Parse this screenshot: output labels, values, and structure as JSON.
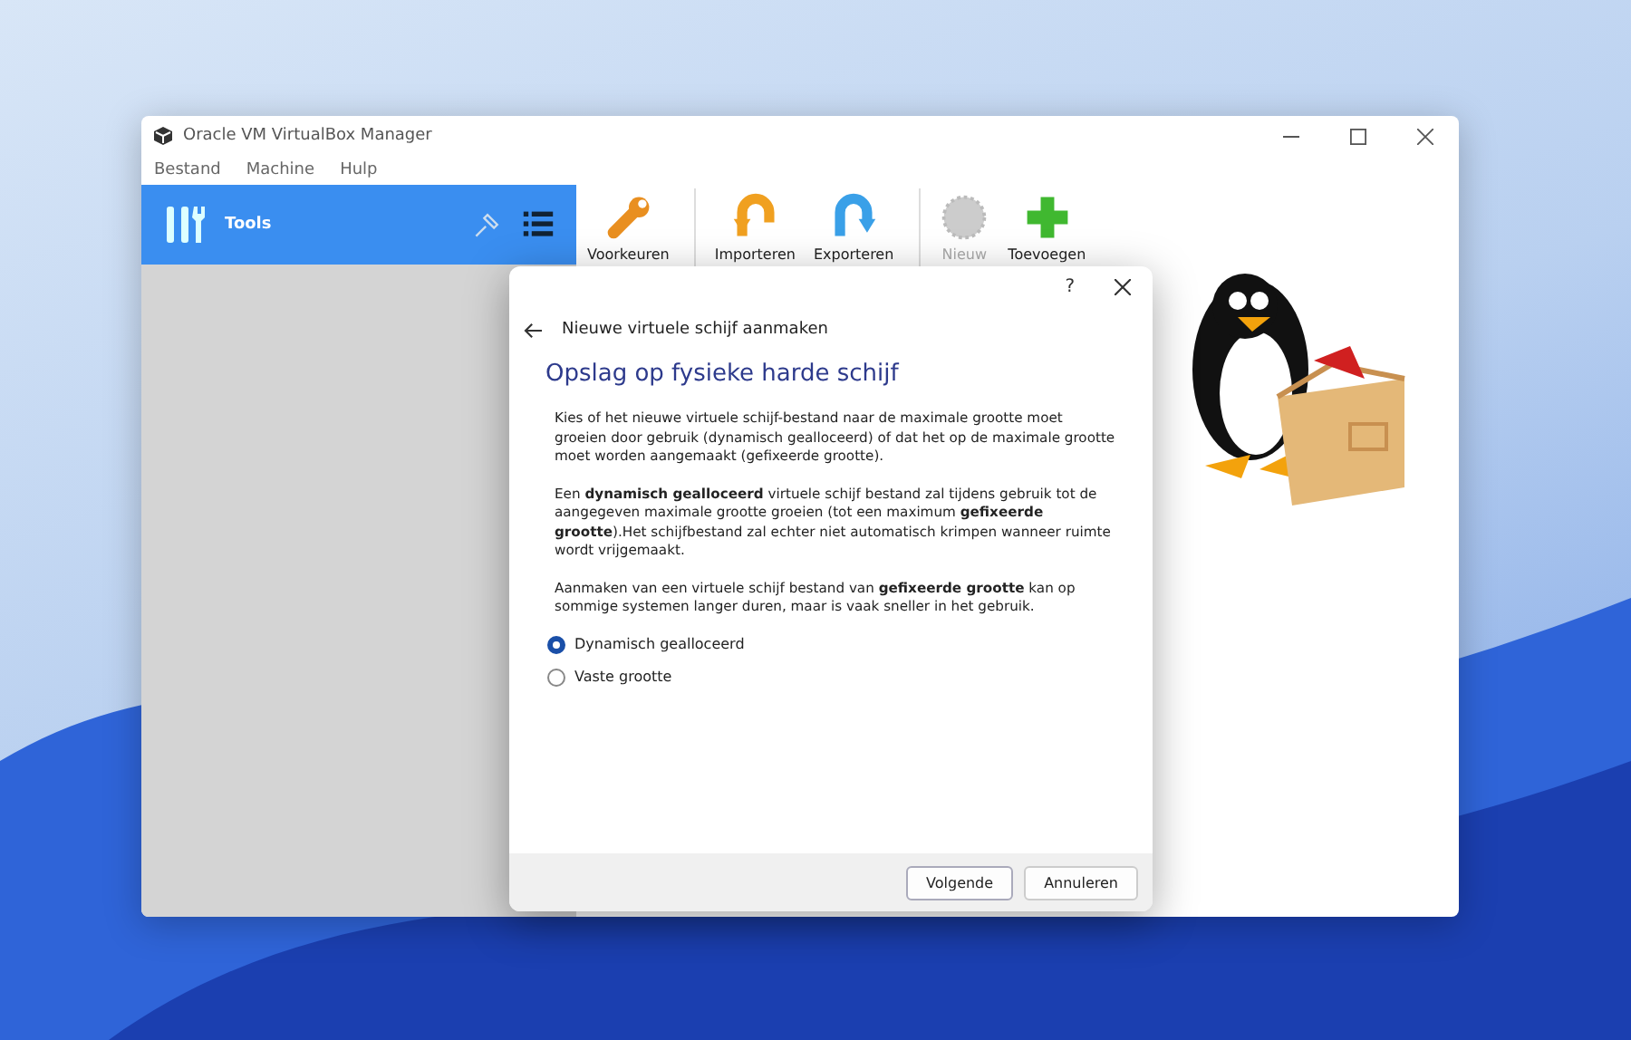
{
  "window": {
    "title": "Oracle VM VirtualBox Manager"
  },
  "menu": [
    "Bestand",
    "Machine",
    "Hulp"
  ],
  "sidebar": {
    "header": "Tools"
  },
  "toolbar": [
    {
      "label": "Voorkeuren",
      "kind": "wrench",
      "disabled": false
    },
    {
      "label": "Importeren",
      "kind": "import",
      "disabled": false
    },
    {
      "label": "Exporteren",
      "kind": "export",
      "disabled": false
    },
    {
      "label": "Nieuw",
      "kind": "new",
      "disabled": true
    },
    {
      "label": "Toevoegen",
      "kind": "add",
      "disabled": false
    }
  ],
  "dialog": {
    "help": "?",
    "title": "Nieuwe virtuele schijf aanmaken",
    "heading": "Opslag op fysieke harde schijf",
    "paragraphs": [
      "Kies of het nieuwe virtuele schijf-bestand naar de maximale grootte moet groeien door gebruik (dynamisch gealloceerd) of dat het op de maximale grootte moet worden aangemaakt (gefixeerde grootte).",
      "Een **dynamisch gealloceerd** virtuele schijf bestand zal tijdens gebruik tot de aangegeven maximale grootte groeien (tot een maximum **gefixeerde grootte**).Het schijfbestand zal echter niet automatisch krimpen wanneer ruimte wordt vrijgemaakt.",
      "Aanmaken van een virtuele schijf bestand van **gefixeerde grootte** kan op sommige systemen langer duren, maar is vaak sneller in het gebruik."
    ],
    "options": [
      {
        "label": "Dynamisch gealloceerd",
        "selected": true
      },
      {
        "label": "Vaste grootte",
        "selected": false
      }
    ],
    "buttons": [
      {
        "label": "Volgende",
        "default": true
      },
      {
        "label": "Annuleren",
        "default": false
      }
    ]
  }
}
